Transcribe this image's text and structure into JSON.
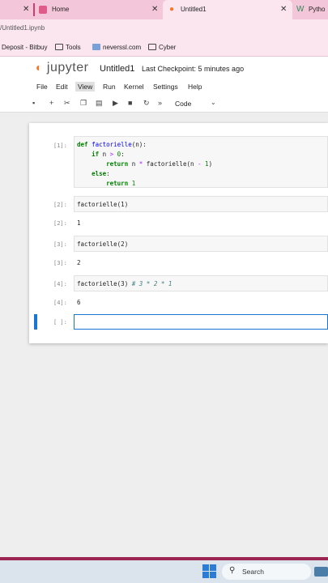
{
  "browser": {
    "tabs": [
      {
        "title": "Home"
      },
      {
        "title": "Untitled1"
      },
      {
        "title": "Pytho"
      }
    ],
    "url": "/Untitled1.ipynb",
    "bookmarks": [
      "Deposit - Bitbuy",
      "Tools",
      "neverssl.com",
      "Cyber"
    ]
  },
  "jupyter": {
    "logo_text": "jupyter",
    "notebook_title": "Untitled1",
    "checkpoint": "Last Checkpoint: 5 minutes ago",
    "menu": [
      "File",
      "Edit",
      "View",
      "Run",
      "Kernel",
      "Settings",
      "Help"
    ],
    "cell_type": "Code"
  },
  "cells": [
    {
      "in_prompt": "[1]:",
      "lines": [
        "def factorielle(n):",
        "    if n > 0:",
        "        return n * factorielle(n - 1)",
        "    else:",
        "        return 1"
      ]
    },
    {
      "in_prompt": "[2]:",
      "code": "factorielle(1)",
      "out_prompt": "[2]:",
      "output": "1"
    },
    {
      "in_prompt": "[3]:",
      "code": "factorielle(2)",
      "out_prompt": "[3]:",
      "output": "2"
    },
    {
      "in_prompt": "[4]:",
      "code": "factorielle(3)",
      "comment": "# 3 * 2 * 1",
      "out_prompt": "[4]:",
      "output": "6"
    },
    {
      "in_prompt": "[ ]:",
      "code": ""
    }
  ],
  "taskbar": {
    "search_label": "Search",
    "accent_color": "#2b7cd6"
  }
}
